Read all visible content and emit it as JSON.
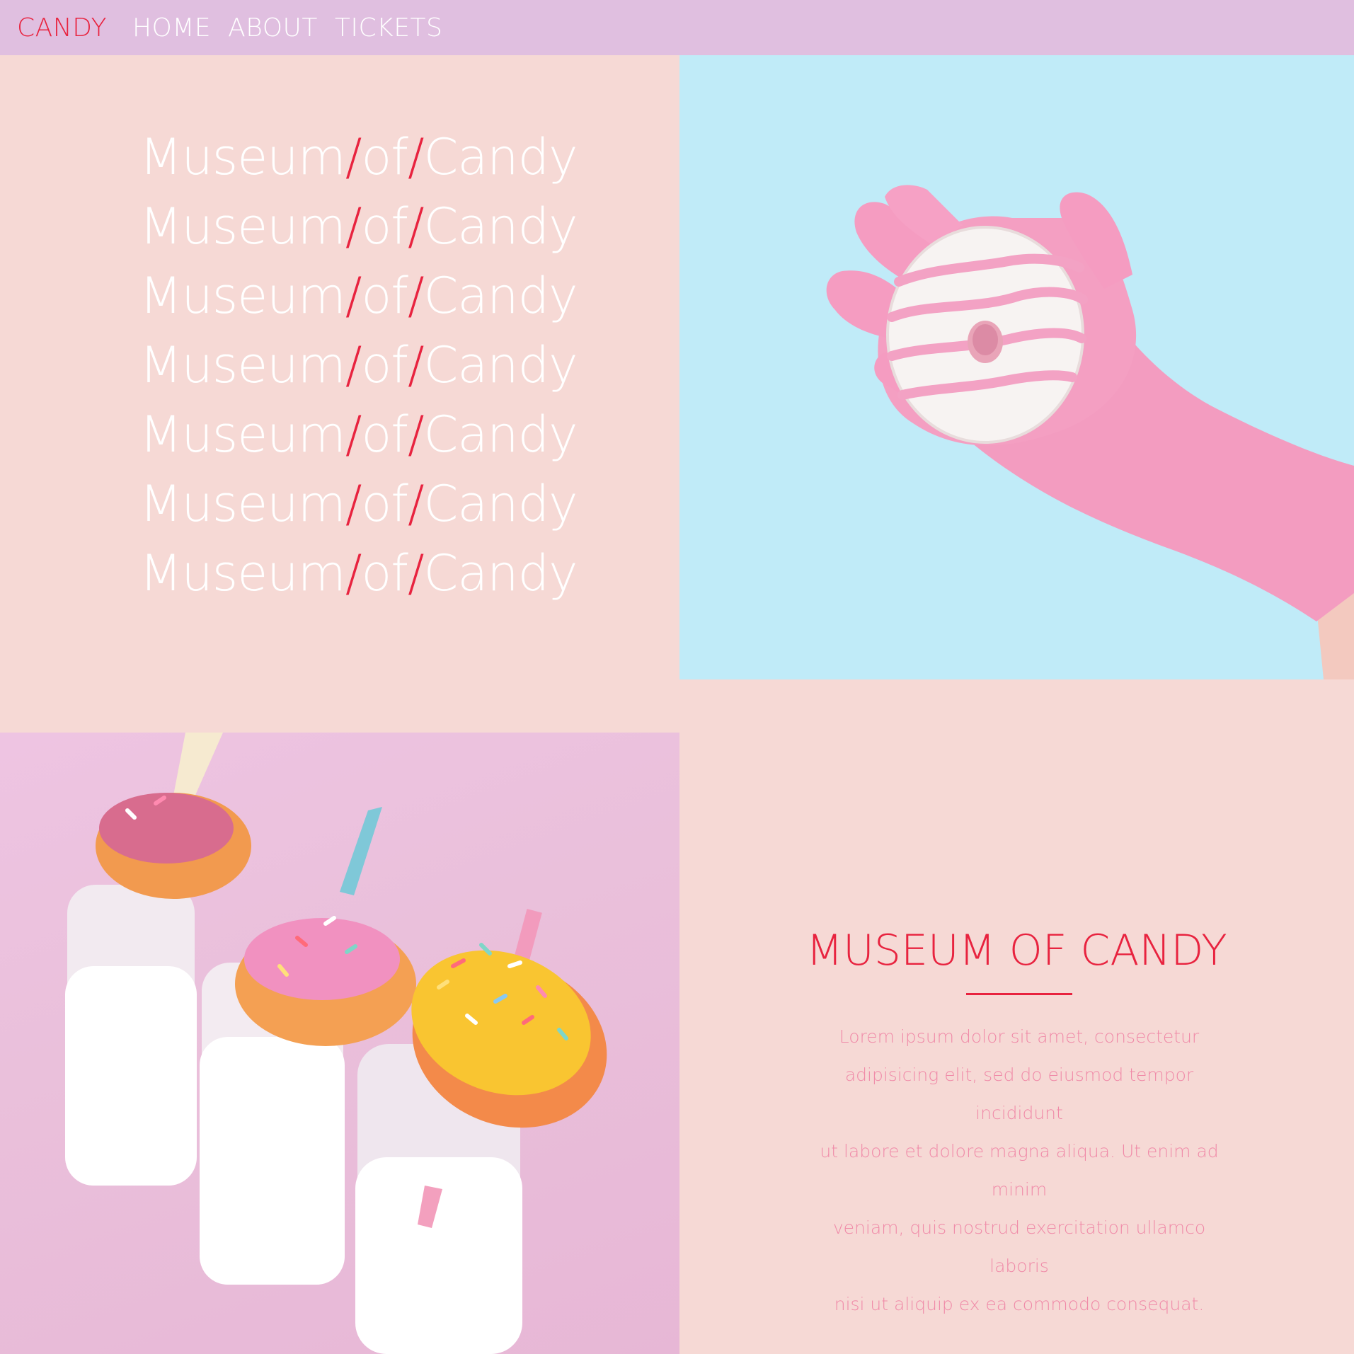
{
  "nav": {
    "brand": "CANDY",
    "links": [
      "HOME",
      "ABOUT",
      "TICKETS"
    ]
  },
  "hero": {
    "lines": [
      {
        "a": "Museum",
        "sep1": "/",
        "b": "of",
        "sep2": "/",
        "c": "Candy"
      },
      {
        "a": "Museum",
        "sep1": "/",
        "b": "of",
        "sep2": "/",
        "c": "Candy"
      },
      {
        "a": "Museum",
        "sep1": "/",
        "b": "of",
        "sep2": "/",
        "c": "Candy"
      },
      {
        "a": "Museum",
        "sep1": "/",
        "b": "of",
        "sep2": "/",
        "c": "Candy"
      },
      {
        "a": "Museum",
        "sep1": "/",
        "b": "of",
        "sep2": "/",
        "c": "Candy"
      },
      {
        "a": "Museum",
        "sep1": "/",
        "b": "of",
        "sep2": "/",
        "c": "Candy"
      },
      {
        "a": "Museum",
        "sep1": "/",
        "b": "of",
        "sep2": "/",
        "c": "Candy"
      }
    ]
  },
  "info": {
    "title": "MUSEUM OF CANDY",
    "body_lines": [
      "Lorem ipsum dolor sit amet, consectetur",
      "adipisicing elit, sed do eiusmod tempor incididunt",
      "ut labore et dolore magna aliqua. Ut enim ad minim",
      "veniam, quis nostrud exercitation ullamco laboris",
      "nisi ut aliquip ex ea commodo consequat."
    ]
  },
  "colors": {
    "nav_bg": "#e0bfe0",
    "accent": "#e8233f",
    "page_bg": "#f6d9d5",
    "sky": "#c0ebf8",
    "body_text": "#f08aa8"
  }
}
